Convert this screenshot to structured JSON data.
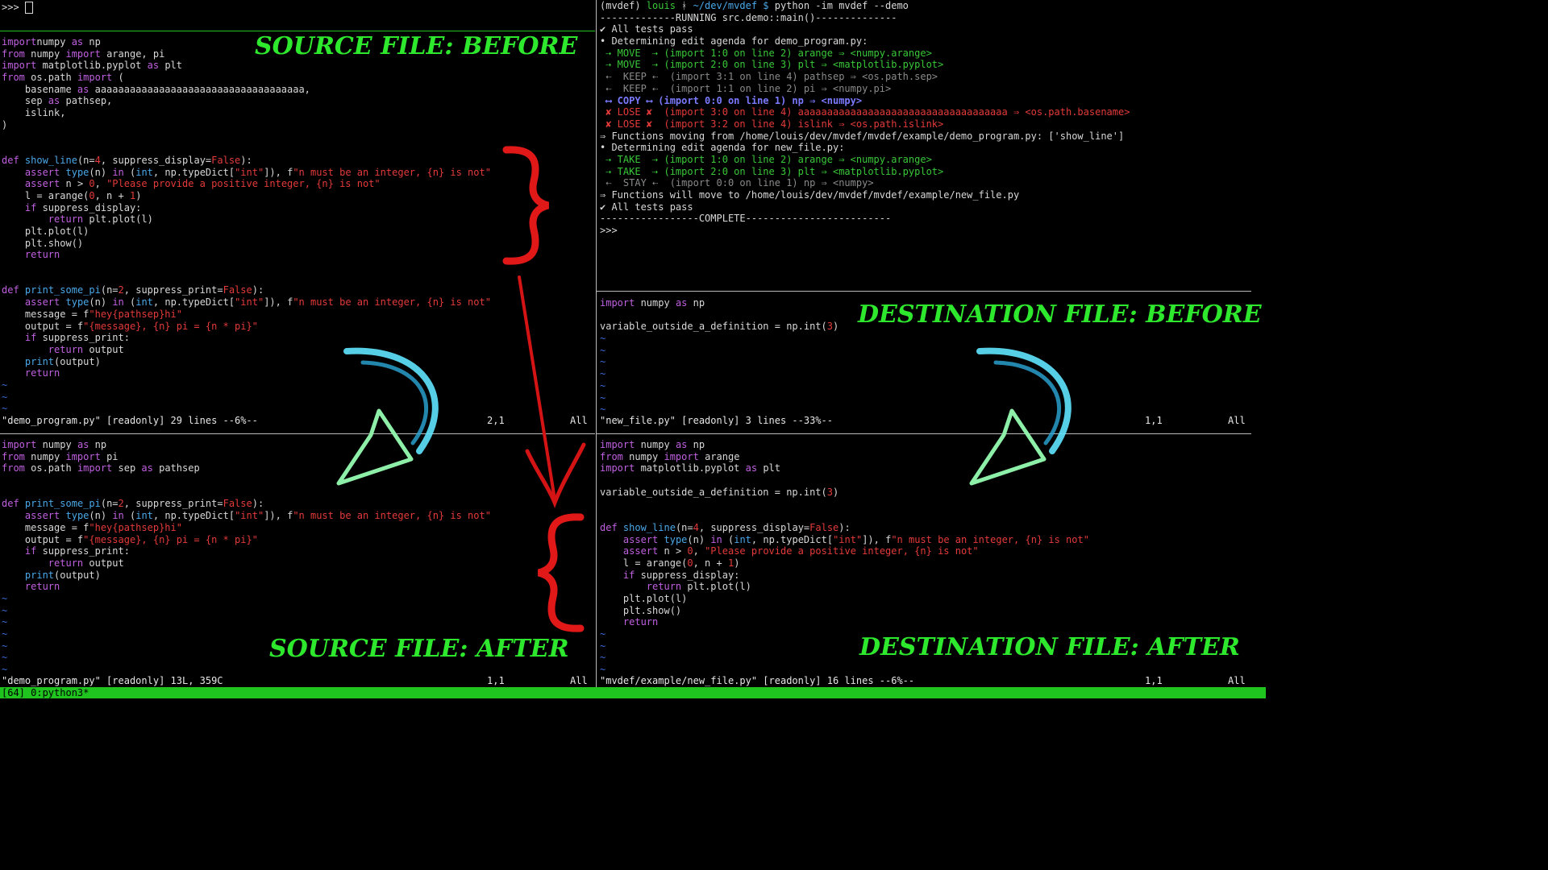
{
  "prompt": {
    "text": ">>> "
  },
  "source_before": {
    "label": "SOURCE FILE: BEFORE",
    "lines": [
      [
        [
          "kw",
          "import"
        ],
        [
          "",
          "numpy"
        ],
        [
          "kw",
          " as "
        ],
        [
          "",
          "np"
        ]
      ],
      [
        [
          "kw",
          "from"
        ],
        [
          "",
          " numpy "
        ],
        [
          "kw",
          "import"
        ],
        [
          "",
          " arange, pi"
        ]
      ],
      [
        [
          "kw",
          "import"
        ],
        [
          "",
          " matplotlib.pyplot "
        ],
        [
          "kw",
          "as"
        ],
        [
          "",
          " plt"
        ]
      ],
      [
        [
          "kw",
          "from"
        ],
        [
          "",
          " os.path "
        ],
        [
          "kw",
          "import"
        ],
        [
          "",
          " ("
        ]
      ],
      [
        [
          "",
          "    basename "
        ],
        [
          "kw",
          "as"
        ],
        [
          "",
          " aaaaaaaaaaaaaaaaaaaaaaaaaaaaaaaaaaaa,"
        ]
      ],
      [
        [
          "",
          "    sep "
        ],
        [
          "kw",
          "as"
        ],
        [
          "",
          " pathsep,"
        ]
      ],
      [
        [
          "",
          "    islink,"
        ]
      ],
      [
        [
          "",
          ")"
        ]
      ],
      [
        [
          "",
          ""
        ]
      ],
      [
        [
          "",
          ""
        ]
      ],
      [
        [
          "kw",
          "def"
        ],
        [
          "",
          " "
        ],
        [
          "fn",
          "show_line"
        ],
        [
          "",
          "(n="
        ],
        [
          "num",
          "4"
        ],
        [
          "",
          ", suppress_display="
        ],
        [
          "num",
          "False"
        ],
        [
          "",
          "):"
        ]
      ],
      [
        [
          "",
          "    "
        ],
        [
          "kw",
          "assert"
        ],
        [
          "",
          " "
        ],
        [
          "fn",
          "type"
        ],
        [
          "",
          "(n) "
        ],
        [
          "kw",
          "in"
        ],
        [
          "",
          " ("
        ],
        [
          "fn",
          "int"
        ],
        [
          "",
          ", np.typeDict["
        ],
        [
          "str",
          "\"int\""
        ],
        [
          "",
          "]), f"
        ],
        [
          "str",
          "\"n must be an integer, {n} is not\""
        ]
      ],
      [
        [
          "",
          "    "
        ],
        [
          "kw",
          "assert"
        ],
        [
          "",
          " n > "
        ],
        [
          "num",
          "0"
        ],
        [
          "",
          ", "
        ],
        [
          "str",
          "\"Please provide a positive integer, {n} is not\""
        ]
      ],
      [
        [
          "",
          "    l = arange("
        ],
        [
          "num",
          "0"
        ],
        [
          "",
          ", n + "
        ],
        [
          "num",
          "1"
        ],
        [
          "",
          ")"
        ]
      ],
      [
        [
          "",
          "    "
        ],
        [
          "kw",
          "if"
        ],
        [
          "",
          " suppress_display:"
        ]
      ],
      [
        [
          "",
          "        "
        ],
        [
          "kw",
          "return"
        ],
        [
          "",
          " plt.plot(l)"
        ]
      ],
      [
        [
          "",
          "    plt.plot(l)"
        ]
      ],
      [
        [
          "",
          "    plt.show()"
        ]
      ],
      [
        [
          "",
          "    "
        ],
        [
          "kw",
          "return"
        ]
      ],
      [
        [
          "",
          ""
        ]
      ],
      [
        [
          "",
          ""
        ]
      ],
      [
        [
          "kw",
          "def"
        ],
        [
          "",
          " "
        ],
        [
          "fn",
          "print_some_pi"
        ],
        [
          "",
          "(n="
        ],
        [
          "num",
          "2"
        ],
        [
          "",
          ", suppress_print="
        ],
        [
          "num",
          "False"
        ],
        [
          "",
          "):"
        ]
      ],
      [
        [
          "",
          "    "
        ],
        [
          "kw",
          "assert"
        ],
        [
          "",
          " "
        ],
        [
          "fn",
          "type"
        ],
        [
          "",
          "(n) "
        ],
        [
          "kw",
          "in"
        ],
        [
          "",
          " ("
        ],
        [
          "fn",
          "int"
        ],
        [
          "",
          ", np.typeDict["
        ],
        [
          "str",
          "\"int\""
        ],
        [
          "",
          "]), f"
        ],
        [
          "str",
          "\"n must be an integer, {n} is not\""
        ]
      ],
      [
        [
          "",
          "    message = f"
        ],
        [
          "str",
          "\"hey{pathsep}hi\""
        ]
      ],
      [
        [
          "",
          "    output = f"
        ],
        [
          "str",
          "\"{message}, {n} pi = {n * pi}\""
        ]
      ],
      [
        [
          "",
          "    "
        ],
        [
          "kw",
          "if"
        ],
        [
          "",
          " suppress_print:"
        ]
      ],
      [
        [
          "",
          "        "
        ],
        [
          "kw",
          "return"
        ],
        [
          "",
          " output"
        ]
      ],
      [
        [
          "",
          "    "
        ],
        [
          "fn",
          "print"
        ],
        [
          "",
          "(output)"
        ]
      ],
      [
        [
          "",
          "    "
        ],
        [
          "kw",
          "return"
        ]
      ],
      [
        [
          "tilde",
          "~"
        ]
      ],
      [
        [
          "tilde",
          "~"
        ]
      ],
      [
        [
          "tilde",
          "~"
        ]
      ]
    ],
    "status": "\"demo_program.py\" [readonly] 29 lines --6%--",
    "pos": "2,1",
    "scroll": "All"
  },
  "source_after": {
    "label": "SOURCE FILE: AFTER",
    "lines": [
      [
        [
          "kw",
          "import"
        ],
        [
          "",
          " numpy "
        ],
        [
          "kw",
          "as"
        ],
        [
          "",
          " np"
        ]
      ],
      [
        [
          "kw",
          "from"
        ],
        [
          "",
          " numpy "
        ],
        [
          "kw",
          "import"
        ],
        [
          "",
          " pi"
        ]
      ],
      [
        [
          "kw",
          "from"
        ],
        [
          "",
          " os.path "
        ],
        [
          "kw",
          "import"
        ],
        [
          "",
          " sep "
        ],
        [
          "kw",
          "as"
        ],
        [
          "",
          " pathsep"
        ]
      ],
      [
        [
          "",
          ""
        ]
      ],
      [
        [
          "",
          ""
        ]
      ],
      [
        [
          "kw",
          "def"
        ],
        [
          "",
          " "
        ],
        [
          "fn",
          "print_some_pi"
        ],
        [
          "",
          "(n="
        ],
        [
          "num",
          "2"
        ],
        [
          "",
          ", suppress_print="
        ],
        [
          "num",
          "False"
        ],
        [
          "",
          "):"
        ]
      ],
      [
        [
          "",
          "    "
        ],
        [
          "kw",
          "assert"
        ],
        [
          "",
          " "
        ],
        [
          "fn",
          "type"
        ],
        [
          "",
          "(n) "
        ],
        [
          "kw",
          "in"
        ],
        [
          "",
          " ("
        ],
        [
          "fn",
          "int"
        ],
        [
          "",
          ", np.typeDict["
        ],
        [
          "str",
          "\"int\""
        ],
        [
          "",
          "]), f"
        ],
        [
          "str",
          "\"n must be an integer, {n} is not\""
        ]
      ],
      [
        [
          "",
          "    message = f"
        ],
        [
          "str",
          "\"hey{pathsep}hi\""
        ]
      ],
      [
        [
          "",
          "    output = f"
        ],
        [
          "str",
          "\"{message}, {n} pi = {n * pi}\""
        ]
      ],
      [
        [
          "",
          "    "
        ],
        [
          "kw",
          "if"
        ],
        [
          "",
          " suppress_print:"
        ]
      ],
      [
        [
          "",
          "        "
        ],
        [
          "kw",
          "return"
        ],
        [
          "",
          " output"
        ]
      ],
      [
        [
          "",
          "    "
        ],
        [
          "fn",
          "print"
        ],
        [
          "",
          "(output)"
        ]
      ],
      [
        [
          "",
          "    "
        ],
        [
          "kw",
          "return"
        ]
      ],
      [
        [
          "tilde",
          "~"
        ]
      ],
      [
        [
          "tilde",
          "~"
        ]
      ],
      [
        [
          "tilde",
          "~"
        ]
      ],
      [
        [
          "tilde",
          "~"
        ]
      ],
      [
        [
          "tilde",
          "~"
        ]
      ],
      [
        [
          "tilde",
          "~"
        ]
      ],
      [
        [
          "tilde",
          "~"
        ]
      ]
    ],
    "status": "\"demo_program.py\" [readonly] 13L, 359C",
    "pos": "1,1",
    "scroll": "All"
  },
  "terminal": {
    "lines": [
      [
        [
          "",
          "(mvdef) "
        ],
        [
          "grn",
          "louis"
        ],
        [
          "",
          " ᚼ "
        ],
        [
          "fn",
          "~/dev/mvdef $"
        ],
        [
          "",
          " python -im mvdef --demo"
        ]
      ],
      [
        [
          "",
          "-------------RUNNING src.demo::main()--------------"
        ]
      ],
      [
        [
          "",
          "✔ All tests pass"
        ]
      ],
      [
        [
          "",
          "• Determining edit agenda for demo_program.py:"
        ]
      ],
      [
        [
          "grn",
          " ⇢ MOVE  ⇢ (import 1:0 on line 2) arange ⇒ <numpy.arange>"
        ]
      ],
      [
        [
          "grn",
          " ⇢ MOVE  ⇢ (import 2:0 on line 3) plt ⇒ <matplotlib.pyplot>"
        ]
      ],
      [
        [
          "gry",
          " ⇠  KEEP ⇠  (import 3:1 on line 4) pathsep ⇒ <os.path.sep>"
        ]
      ],
      [
        [
          "gry",
          " ⇠  KEEP ⇠  (import 1:1 on line 2) pi ⇒ <numpy.pi>"
        ]
      ],
      [
        [
          "blu",
          " ⟷ COPY ⟷ (import 0:0 on line 1) np ⇒ <numpy>"
        ]
      ],
      [
        [
          "red",
          " ✘ LOSE ✘  (import 3:0 on line 4) aaaaaaaaaaaaaaaaaaaaaaaaaaaaaaaaaaaa ⇒ <os.path.basename>"
        ]
      ],
      [
        [
          "red",
          " ✘ LOSE ✘  (import 3:2 on line 4) islink ⇒ <os.path.islink>"
        ]
      ],
      [
        [
          "",
          "⇒ Functions moving from /home/louis/dev/mvdef/mvdef/example/demo_program.py: ['show_line']"
        ]
      ],
      [
        [
          "",
          "• Determining edit agenda for new_file.py:"
        ]
      ],
      [
        [
          "grn",
          " ⇢ TAKE  ⇢ (import 1:0 on line 2) arange ⇒ <numpy.arange>"
        ]
      ],
      [
        [
          "grn",
          " ⇢ TAKE  ⇢ (import 2:0 on line 3) plt ⇒ <matplotlib.pyplot>"
        ]
      ],
      [
        [
          "gry",
          " ⇠  STAY ⇠  (import 0:0 on line 1) np ⇒ <numpy>"
        ]
      ],
      [
        [
          "",
          "⇒ Functions will move to /home/louis/dev/mvdef/mvdef/example/new_file.py"
        ]
      ],
      [
        [
          "",
          "✔ All tests pass"
        ]
      ],
      [
        [
          "",
          "-----------------COMPLETE-------------------------"
        ]
      ],
      [
        [
          "",
          ">>>"
        ]
      ]
    ]
  },
  "dest_before": {
    "label": "DESTINATION FILE: BEFORE",
    "lines": [
      [
        [
          "kw",
          "import"
        ],
        [
          "",
          " numpy "
        ],
        [
          "kw",
          "as"
        ],
        [
          "",
          " np"
        ]
      ],
      [
        [
          "",
          ""
        ]
      ],
      [
        [
          "",
          "variable_outside_a_definition = np.int("
        ],
        [
          "num",
          "3"
        ],
        [
          "",
          ")"
        ]
      ],
      [
        [
          "tilde",
          "~"
        ]
      ],
      [
        [
          "tilde",
          "~"
        ]
      ],
      [
        [
          "tilde",
          "~"
        ]
      ],
      [
        [
          "tilde",
          "~"
        ]
      ],
      [
        [
          "tilde",
          "~"
        ]
      ],
      [
        [
          "tilde",
          "~"
        ]
      ],
      [
        [
          "tilde",
          "~"
        ]
      ]
    ],
    "status": "\"new_file.py\" [readonly] 3 lines --33%--",
    "pos": "1,1",
    "scroll": "All"
  },
  "dest_after": {
    "label": "DESTINATION FILE: AFTER",
    "lines": [
      [
        [
          "kw",
          "import"
        ],
        [
          "",
          " numpy "
        ],
        [
          "kw",
          "as"
        ],
        [
          "",
          " np"
        ]
      ],
      [
        [
          "kw",
          "from"
        ],
        [
          "",
          " numpy "
        ],
        [
          "kw",
          "import"
        ],
        [
          "",
          " arange"
        ]
      ],
      [
        [
          "kw",
          "import"
        ],
        [
          "",
          " matplotlib.pyplot "
        ],
        [
          "kw",
          "as"
        ],
        [
          "",
          " plt"
        ]
      ],
      [
        [
          "",
          ""
        ]
      ],
      [
        [
          "",
          "variable_outside_a_definition = np.int("
        ],
        [
          "num",
          "3"
        ],
        [
          "",
          ")"
        ]
      ],
      [
        [
          "",
          ""
        ]
      ],
      [
        [
          "",
          ""
        ]
      ],
      [
        [
          "kw",
          "def"
        ],
        [
          "",
          " "
        ],
        [
          "fn",
          "show_line"
        ],
        [
          "",
          "(n="
        ],
        [
          "num",
          "4"
        ],
        [
          "",
          ", suppress_display="
        ],
        [
          "num",
          "False"
        ],
        [
          "",
          "):"
        ]
      ],
      [
        [
          "",
          "    "
        ],
        [
          "kw",
          "assert"
        ],
        [
          "",
          " "
        ],
        [
          "fn",
          "type"
        ],
        [
          "",
          "(n) "
        ],
        [
          "kw",
          "in"
        ],
        [
          "",
          " ("
        ],
        [
          "fn",
          "int"
        ],
        [
          "",
          ", np.typeDict["
        ],
        [
          "str",
          "\"int\""
        ],
        [
          "",
          "]), f"
        ],
        [
          "str",
          "\"n must be an integer, {n} is not\""
        ]
      ],
      [
        [
          "",
          "    "
        ],
        [
          "kw",
          "assert"
        ],
        [
          "",
          " n > "
        ],
        [
          "num",
          "0"
        ],
        [
          "",
          ", "
        ],
        [
          "str",
          "\"Please provide a positive integer, {n} is not\""
        ]
      ],
      [
        [
          "",
          "    l = arange("
        ],
        [
          "num",
          "0"
        ],
        [
          "",
          ", n + "
        ],
        [
          "num",
          "1"
        ],
        [
          "",
          ")"
        ]
      ],
      [
        [
          "",
          "    "
        ],
        [
          "kw",
          "if"
        ],
        [
          "",
          " suppress_display:"
        ]
      ],
      [
        [
          "",
          "        "
        ],
        [
          "kw",
          "return"
        ],
        [
          "",
          " plt.plot(l)"
        ]
      ],
      [
        [
          "",
          "    plt.plot(l)"
        ]
      ],
      [
        [
          "",
          "    plt.show()"
        ]
      ],
      [
        [
          "",
          "    "
        ],
        [
          "kw",
          "return"
        ]
      ],
      [
        [
          "tilde",
          "~"
        ]
      ],
      [
        [
          "tilde",
          "~"
        ]
      ],
      [
        [
          "tilde",
          "~"
        ]
      ],
      [
        [
          "tilde",
          "~"
        ]
      ]
    ],
    "status": "\"mvdef/example/new_file.py\" [readonly] 16 lines --6%--",
    "pos": "1,1",
    "scroll": "All"
  },
  "tmux": {
    "text": "[64] 0:python3*"
  },
  "colors": {
    "label": "#2ee82e",
    "tmux_bar": "#1fc41f",
    "arrow_red": "#e01818",
    "arrow_cyan": "#5fe6ff"
  }
}
